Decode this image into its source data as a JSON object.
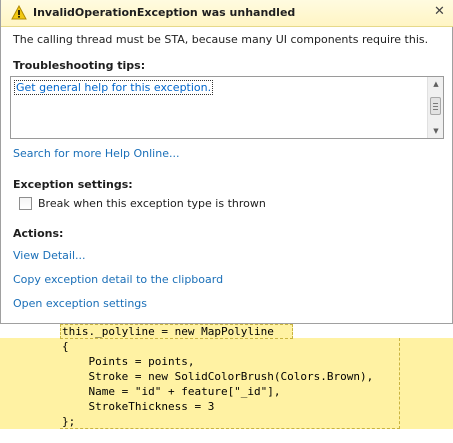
{
  "dialog": {
    "title": "InvalidOperationException was unhandled",
    "close_glyph": "✕",
    "message": "The calling thread must be STA, because many UI components require this.",
    "tips_label": "Troubleshooting tips:",
    "tips_items": [
      "Get general help for this exception."
    ],
    "search_link": "Search for more Help Online...",
    "settings_label": "Exception settings:",
    "break_checkbox": {
      "label": "Break when this exception type is thrown",
      "checked": false
    },
    "actions_label": "Actions:",
    "actions": [
      "View Detail...",
      "Copy exception detail to the clipboard",
      "Open exception settings"
    ],
    "icons": {
      "warning": "warning-triangle-icon",
      "close": "close-icon"
    },
    "colors": {
      "header_bg": "#fff5c4",
      "link": "#1a6fb8",
      "warning": "#f2c811"
    }
  },
  "code_editor": {
    "highlight_color": "#fff2a3",
    "lines": [
      "this._polyline = new MapPolyline",
      "{",
      "    Points = points,",
      "    Stroke = new SolidColorBrush(Colors.Brown),",
      "    Name = \"id\" + feature[\"_id\"],",
      "    StrokeThickness = 3",
      "};"
    ]
  }
}
